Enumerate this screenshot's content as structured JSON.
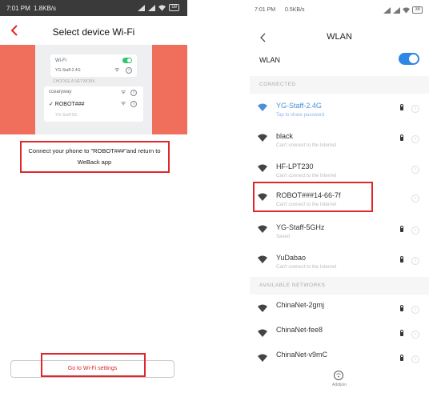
{
  "left_screen": {
    "status": {
      "time": "7:01 PM",
      "speed": "1.8KB/s",
      "battery": "58"
    },
    "header": {
      "title": "Select device Wi-Fi"
    },
    "illustration": {
      "row1_label": "Wi-Fi",
      "row2_label": "YG-Staff-2.4G",
      "section_label": "CHOOSE A NETWORK",
      "row3_label": "ccearyway",
      "row4_label": "✓ ROBOT###",
      "row5_label": "YG-Staff-5G"
    },
    "instruction": {
      "line1": "Connect your phone to \"ROBOT###\"and return to",
      "line2": "WeBack app"
    },
    "button": {
      "label": "Go to Wi-Fi settings"
    },
    "colors": {
      "banner": "#ef6f5c",
      "highlight": "#e0262b"
    }
  },
  "right_screen": {
    "status": {
      "time": "7:01 PM",
      "speed": "0.5KB/s",
      "battery": "38"
    },
    "header": {
      "title": "WLAN"
    },
    "wlan_toggle": {
      "label": "WLAN",
      "on": true
    },
    "sections": {
      "connected": "CONNECTED",
      "available": "AVAILABLE NETWORKS"
    },
    "connected_networks": [
      {
        "name": "YG-Staff-2.4G",
        "sub": "Tap to share password",
        "locked": true,
        "active": true
      },
      {
        "name": "black",
        "sub": "Can't connect to the Internet",
        "locked": true,
        "active": false
      },
      {
        "name": "HF-LPT230",
        "sub": "Can't connect to the Internet",
        "locked": false,
        "active": false
      },
      {
        "name": "ROBOT###14-66-7f",
        "sub": "Can't connect to the Internet",
        "locked": false,
        "active": false
      },
      {
        "name": "YG-Staff-5GHz",
        "sub": "Saved",
        "locked": true,
        "active": false
      },
      {
        "name": "YuDabao",
        "sub": "Can't connect to the Internet",
        "locked": true,
        "active": false
      }
    ],
    "available_networks": [
      {
        "name": "ChinaNet-2gmj",
        "locked": true
      },
      {
        "name": "ChinaNet-fee8",
        "locked": true
      },
      {
        "name": "ChinaNet-v9mC",
        "locked": true
      }
    ],
    "footer": {
      "label": "Add/join"
    },
    "colors": {
      "toggle": "#2e86e6",
      "active_network": "#4a8fd8"
    }
  }
}
